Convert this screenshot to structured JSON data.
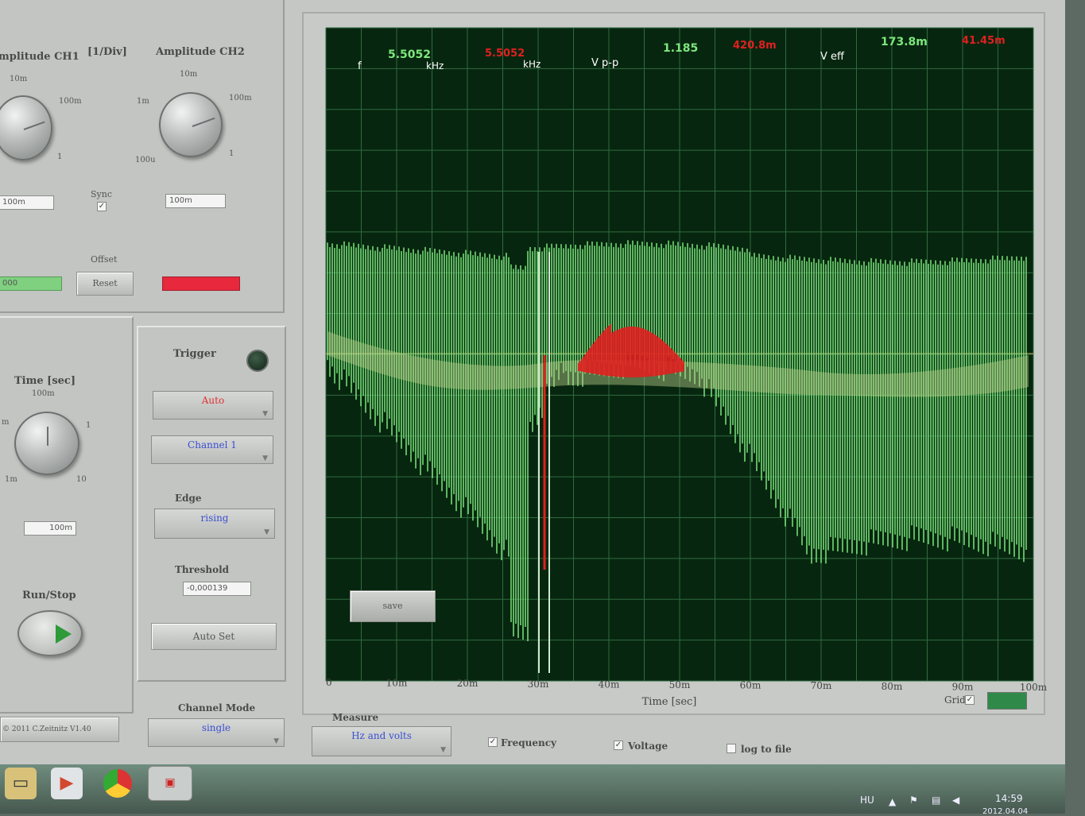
{
  "ch1": {
    "title": "mplitude CH1",
    "div_label": "[1/Div]",
    "knob_labels": [
      "10m",
      "100m",
      "1"
    ],
    "value": "100m"
  },
  "ch2": {
    "title": "Amplitude CH2",
    "knob_labels": [
      "10m",
      "1m",
      "100m",
      "100u",
      "1"
    ],
    "value": "100m"
  },
  "sync": {
    "label": "Sync",
    "checked": "✓"
  },
  "offset": {
    "label": "Offset",
    "ch1_value": "000",
    "reset_label": "Reset"
  },
  "time": {
    "title": "Time [sec]",
    "knob_labels": [
      "100m",
      "m",
      "1",
      "1m",
      "10"
    ],
    "value": "100m"
  },
  "run_stop": {
    "label": "Run/Stop"
  },
  "trigger": {
    "title": "Trigger",
    "mode": "Auto",
    "source": "Channel 1",
    "edge_label": "Edge",
    "edge": "rising",
    "threshold_label": "Threshold",
    "threshold": "-0,000139",
    "autoset_label": "Auto Set"
  },
  "channel_mode": {
    "label": "Channel Mode",
    "value": "single"
  },
  "copyright": "© 2011  C.Zeitnitz V1.40",
  "readout": {
    "f_label": "f",
    "f_ch1": "5.5052",
    "f_ch1_unit": "kHz",
    "f_ch2": "5.5052",
    "f_ch2_unit": "kHz",
    "vpp_label": "V p-p",
    "vpp_ch1": "1.185",
    "vpp_ch2": "420.8m",
    "veff_label": "V eff",
    "veff_ch1": "173.8m",
    "veff_ch2": "41.45m"
  },
  "plot": {
    "save_label": "save",
    "x_ticks": [
      "0",
      "10m",
      "20m",
      "30m",
      "40m",
      "50m",
      "60m",
      "70m",
      "80m",
      "90m",
      "100m"
    ],
    "xlabel": "Time [sec]",
    "grid_label": "Grid",
    "grid_checked": "✓"
  },
  "measure": {
    "label": "Measure",
    "mode": "Hz and volts",
    "frequency_label": "Frequency",
    "voltage_label": "Voltage",
    "log_label": "log to file",
    "check": "✓"
  },
  "tray": {
    "lang": "HU",
    "time": "14:59",
    "date": "2012.04.04"
  },
  "colors": {
    "ch1": "#7de87d",
    "ch2": "#e02020",
    "screen": "#07260f",
    "grid": "#2f6b3f"
  }
}
